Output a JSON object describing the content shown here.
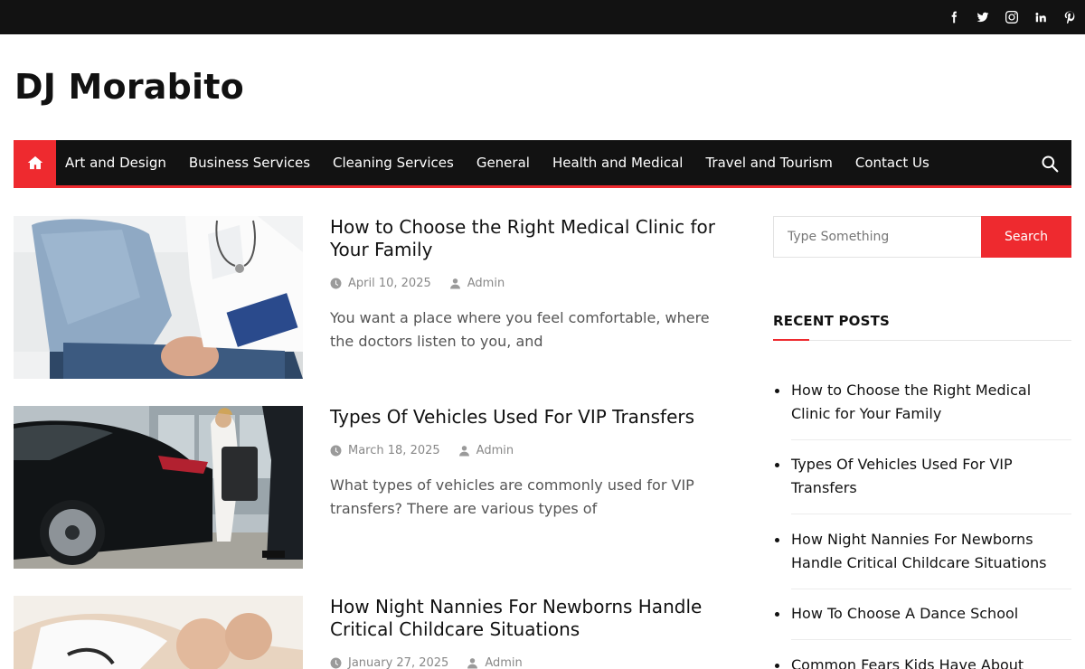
{
  "site": {
    "title": "DJ Morabito"
  },
  "social": [
    "facebook-icon",
    "twitter-icon",
    "instagram-icon",
    "linkedin-icon",
    "pinterest-icon"
  ],
  "nav": {
    "home_icon": "home-icon",
    "items": [
      {
        "label": "Art and Design"
      },
      {
        "label": "Business Services"
      },
      {
        "label": "Cleaning Services"
      },
      {
        "label": "General"
      },
      {
        "label": "Health and Medical"
      },
      {
        "label": "Travel and Tourism"
      },
      {
        "label": "Contact Us"
      }
    ],
    "search_icon": "search-icon"
  },
  "posts": [
    {
      "title": "How to Choose the Right Medical Clinic for Your Family",
      "date": "April 10, 2025",
      "author": "Admin",
      "excerpt": "You want a place where you feel comfortable, where the doctors listen to you, and"
    },
    {
      "title": "Types Of Vehicles Used For VIP Transfers",
      "date": "March 18, 2025",
      "author": "Admin",
      "excerpt": "What types of vehicles are commonly used for VIP transfers? There are various types of"
    },
    {
      "title": "How Night Nannies For Newborns Handle Critical Childcare Situations",
      "date": "January 27, 2025",
      "author": "Admin",
      "excerpt": ""
    }
  ],
  "sidebar": {
    "search": {
      "placeholder": "Type Something",
      "button": "Search"
    },
    "recent_title": "RECENT POSTS",
    "recent": [
      "How to Choose the Right Medical Clinic for Your Family",
      "Types Of Vehicles Used For VIP Transfers",
      "How Night Nannies For Newborns Handle Critical Childcare Situations",
      "How To Choose A Dance School",
      "Common Fears Kids Have About Starting Nursery School"
    ]
  },
  "colors": {
    "accent": "#ee2a2f",
    "dark": "#121212"
  }
}
